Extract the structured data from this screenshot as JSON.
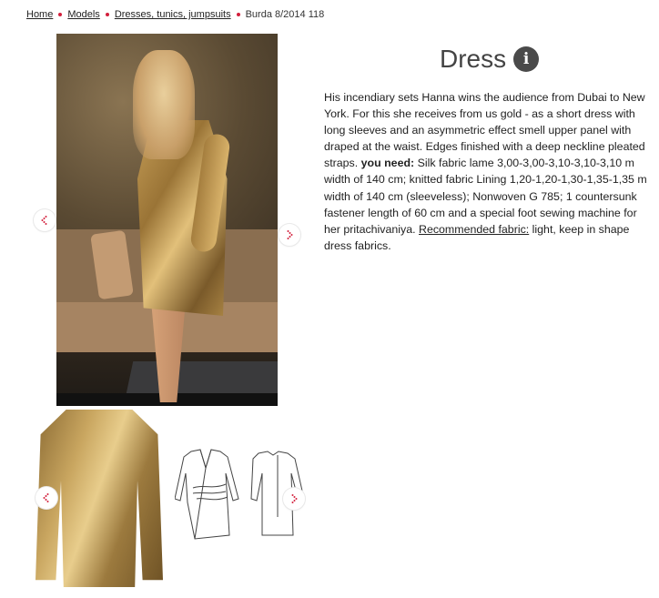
{
  "breadcrumb": {
    "home": "Home",
    "models": "Models",
    "category": "Dresses, tunics, jumpsuits",
    "current": "Burda 8/2014 118"
  },
  "product": {
    "title": "Dress",
    "info_icon": "i",
    "description_intro": "His incendiary sets Hanna wins the audience from Dubai to New York. For this she receives from us gold - as a short dress with long sleeves and an asymmetric effect smell upper panel with draped at the waist. Edges finished with a deep neckline pleated straps. ",
    "you_need_label": "you need:",
    "you_need_text": " Silk fabric lame 3,00-3,00-3,10-3,10-3,10 m width of 140 cm; knitted fabric Lining 1,20-1,20-1,30-1,35-1,35 m width of 140 cm (sleeveless); Nonwoven G 785; 1 countersunk fastener length of 60 cm and a special foot sewing machine for her pritachivaniya. ",
    "recommended_label": "Recommended fabric:",
    "recommended_text": " light, keep in shape dress fabrics."
  },
  "gallery": {
    "prev_icon": "chevron-left-icon",
    "next_icon": "chevron-right-icon",
    "nav_color": "#d21f3c"
  }
}
